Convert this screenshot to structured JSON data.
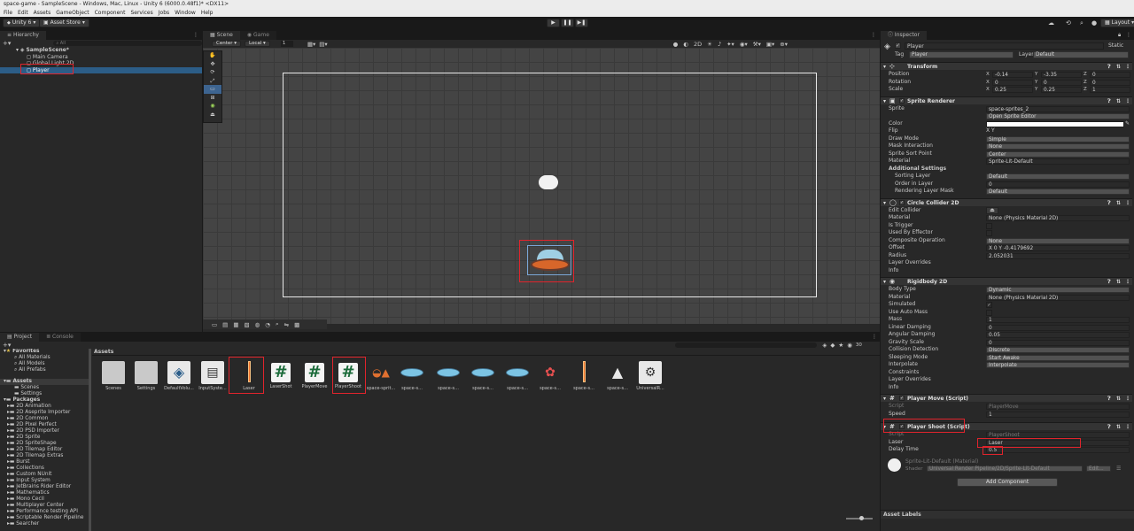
{
  "window": {
    "title": "space-game - SampleScene - Windows, Mac, Linux - Unity 6 (6000.0.48f1)* <DX11>"
  },
  "menu": [
    "File",
    "Edit",
    "Assets",
    "GameObject",
    "Component",
    "Services",
    "Jobs",
    "Window",
    "Help"
  ],
  "toolbar": {
    "account": "Unity 6",
    "asset_store": "Asset Store",
    "layout": "Layout"
  },
  "hierarchy": {
    "tab": "Hierarchy",
    "search_placeholder": "All",
    "items": [
      {
        "label": "SampleScene*"
      },
      {
        "label": "Main Camera"
      },
      {
        "label": "Global Light 2D"
      },
      {
        "label": "Player"
      }
    ]
  },
  "scene": {
    "tabs": [
      "Scene",
      "Game"
    ],
    "pivot": "Center",
    "space": "Local",
    "snap": "1"
  },
  "project": {
    "tabs": [
      "Project",
      "Console"
    ],
    "favorites": {
      "label": "Favorites",
      "items": [
        "All Materials",
        "All Models",
        "All Prefabs"
      ]
    },
    "assets_root": {
      "label": "Assets",
      "items": [
        "Scenes",
        "Settings"
      ]
    },
    "packages_root": {
      "label": "Packages",
      "items": [
        "2D Animation",
        "2D Aseprite Importer",
        "2D Common",
        "2D Pixel Perfect",
        "2D PSD Importer",
        "2D Sprite",
        "2D SpriteShape",
        "2D Tilemap Editor",
        "2D Tilemap Extras",
        "Burst",
        "Collections",
        "Custom NUnit",
        "Input System",
        "JetBrains Rider Editor",
        "Mathematics",
        "Mono Cecil",
        "Multiplayer Center",
        "Performance testing API",
        "Scriptable Render Pipeline",
        "Searcher"
      ]
    },
    "breadcrumb": "Assets",
    "count": "30",
    "assets": [
      {
        "name": "Scenes",
        "kind": "folder"
      },
      {
        "name": "Settings",
        "kind": "folder"
      },
      {
        "name": "DefaultVolu...",
        "kind": "volume"
      },
      {
        "name": "InputSyste...",
        "kind": "input"
      },
      {
        "name": "Laser",
        "kind": "laser"
      },
      {
        "name": "LaserShot",
        "kind": "script"
      },
      {
        "name": "PlayerMove",
        "kind": "script"
      },
      {
        "name": "PlayerShoot",
        "kind": "script"
      },
      {
        "name": "space-sprit...",
        "kind": "sheet"
      },
      {
        "name": "space-s...",
        "kind": "ufo"
      },
      {
        "name": "space-s...",
        "kind": "ufo"
      },
      {
        "name": "space-s...",
        "kind": "ufo"
      },
      {
        "name": "space-s...",
        "kind": "ufo"
      },
      {
        "name": "space-s...",
        "kind": "sprite"
      },
      {
        "name": "space-s...",
        "kind": "laser"
      },
      {
        "name": "space-s...",
        "kind": "rocket"
      },
      {
        "name": "UniversalR...",
        "kind": "urp"
      }
    ]
  },
  "inspector": {
    "tab": "Inspector",
    "object_name": "Player",
    "static_label": "Static",
    "tag_label": "Tag",
    "tag_value": "Player",
    "layer_label": "Layer",
    "layer_value": "Default",
    "transform": {
      "title": "Transform",
      "position": {
        "label": "Position",
        "x": "-0.14",
        "y": "-3.35",
        "z": "0"
      },
      "rotation": {
        "label": "Rotation",
        "x": "0",
        "y": "0",
        "z": "0"
      },
      "scale": {
        "label": "Scale",
        "x": "0.25",
        "y": "0.25",
        "z": "1"
      }
    },
    "sprite_renderer": {
      "title": "Sprite Renderer",
      "rows": [
        {
          "label": "Sprite",
          "value": "space-sprites_2"
        },
        {
          "label": "",
          "value": "Open Sprite Editor"
        },
        {
          "label": "Color",
          "value": ""
        },
        {
          "label": "Flip",
          "value": "X   Y"
        },
        {
          "label": "Draw Mode",
          "value": "Simple"
        },
        {
          "label": "Mask Interaction",
          "value": "None"
        },
        {
          "label": "Sprite Sort Point",
          "value": "Center"
        },
        {
          "label": "Material",
          "value": "Sprite-Lit-Default"
        },
        {
          "label": "Additional Settings",
          "value": ""
        },
        {
          "label": "Sorting Layer",
          "value": "Default"
        },
        {
          "label": "Order in Layer",
          "value": "0"
        },
        {
          "label": "Rendering Layer Mask",
          "value": "Default"
        }
      ]
    },
    "circle_collider": {
      "title": "Circle Collider 2D",
      "rows": [
        {
          "label": "Edit Collider",
          "value": ""
        },
        {
          "label": "Material",
          "value": "None (Physics Material 2D)"
        },
        {
          "label": "Is Trigger",
          "value": ""
        },
        {
          "label": "Used By Effector",
          "value": ""
        },
        {
          "label": "Composite Operation",
          "value": "None"
        },
        {
          "label": "Offset",
          "value": "X  0            Y  -0.4179692"
        },
        {
          "label": "Radius",
          "value": "2.052031"
        },
        {
          "label": "Layer Overrides",
          "value": ""
        },
        {
          "label": "Info",
          "value": ""
        }
      ]
    },
    "rigidbody": {
      "title": "Rigidbody 2D",
      "rows": [
        {
          "label": "Body Type",
          "value": "Dynamic"
        },
        {
          "label": "Material",
          "value": "None (Physics Material 2D)"
        },
        {
          "label": "Simulated",
          "value": ""
        },
        {
          "label": "Use Auto Mass",
          "value": ""
        },
        {
          "label": "Mass",
          "value": "1"
        },
        {
          "label": "Linear Damping",
          "value": "0"
        },
        {
          "label": "Angular Damping",
          "value": "0.05"
        },
        {
          "label": "Gravity Scale",
          "value": "0"
        },
        {
          "label": "Collision Detection",
          "value": "Discrete"
        },
        {
          "label": "Sleeping Mode",
          "value": "Start Awake"
        },
        {
          "label": "Interpolate",
          "value": "Interpolate"
        },
        {
          "label": "Constraints",
          "value": ""
        },
        {
          "label": "Layer Overrides",
          "value": ""
        },
        {
          "label": "Info",
          "value": ""
        }
      ]
    },
    "player_move": {
      "title": "Player Move (Script)",
      "script_label": "Script",
      "script": "PlayerMove",
      "speed_label": "Speed",
      "speed": "1"
    },
    "player_shoot": {
      "title": "Player Shoot (Script)",
      "script_label": "Script",
      "script": "PlayerShoot",
      "laser_label": "Laser",
      "laser": "Laser",
      "delay_label": "Delay Time",
      "delay": "0.5"
    },
    "material": {
      "name": "Sprite-Lit-Default (Material)",
      "shader_label": "Shader",
      "shader": "Universal Render Pipeline/2D/Sprite-Lit-Default",
      "edit": "Edit..."
    },
    "add_component": "Add Component",
    "asset_labels": "Asset Labels"
  }
}
